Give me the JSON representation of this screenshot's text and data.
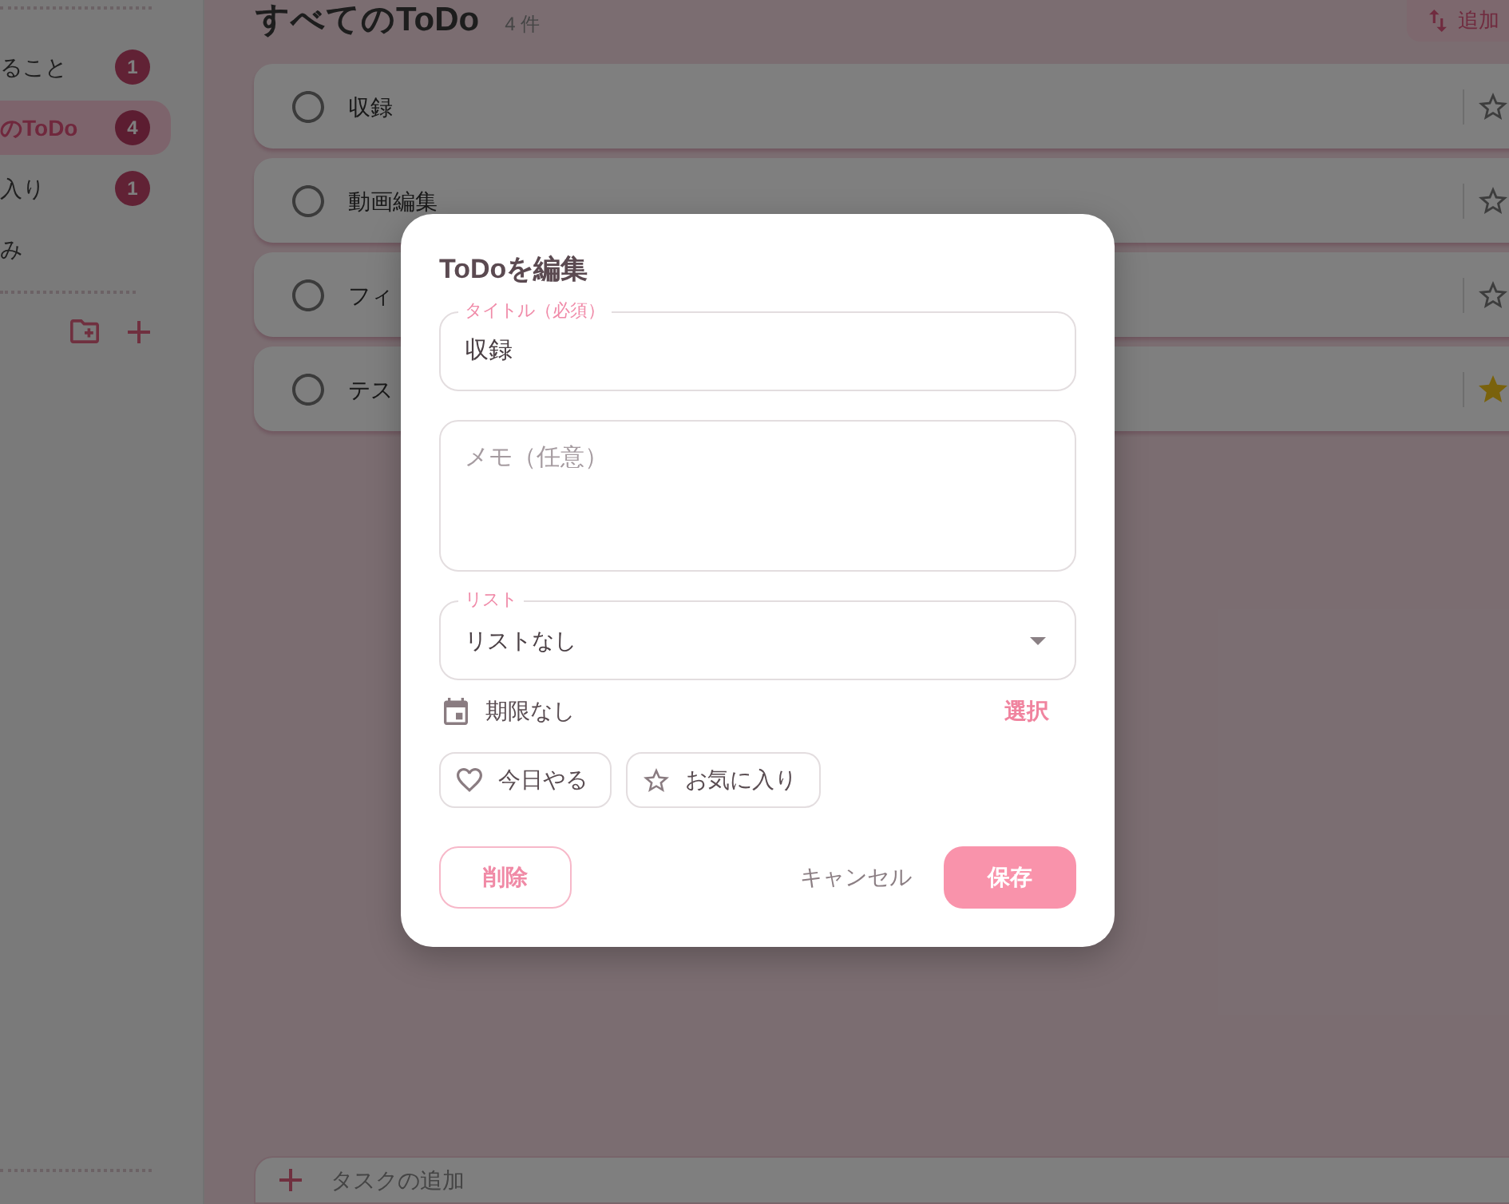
{
  "sidebar": {
    "items": [
      {
        "label": "ること",
        "count": "1",
        "selected": false
      },
      {
        "label": "のToDo",
        "count": "4",
        "selected": true
      },
      {
        "label": "入り",
        "count": "1",
        "selected": false
      },
      {
        "label": "み",
        "selected": false
      }
    ]
  },
  "header": {
    "title": "すべてのToDo",
    "count": "4 件",
    "sort_button": "追加"
  },
  "tasks": [
    {
      "title": "収録",
      "done": false,
      "favorite": false
    },
    {
      "title": "動画編集",
      "done": false,
      "favorite": false
    },
    {
      "title": "フィ",
      "done": false,
      "favorite": false
    },
    {
      "title": "テス",
      "done": false,
      "favorite": true
    }
  ],
  "add_task": {
    "placeholder": "タスクの追加"
  },
  "dialog": {
    "title": "ToDoを編集",
    "title_field": {
      "label": "タイトル（必須）",
      "value": "収録"
    },
    "memo_field": {
      "placeholder": "メモ（任意）"
    },
    "list_field": {
      "label": "リスト",
      "value": "リストなし"
    },
    "due": {
      "value": "期限なし",
      "action": "選択"
    },
    "toggles": [
      {
        "kind": "today",
        "label": "今日やる",
        "on": false
      },
      {
        "kind": "favorite",
        "label": "お気に入り",
        "on": false
      }
    ],
    "buttons": {
      "delete": "削除",
      "cancel": "キャンセル",
      "save": "保存"
    }
  }
}
